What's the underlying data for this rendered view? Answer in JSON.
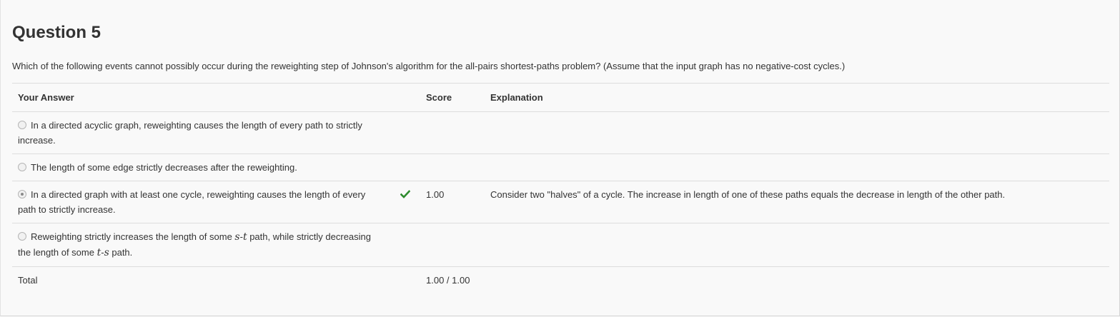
{
  "question": {
    "title": "Question 5",
    "text": "Which of the following events cannot possibly occur during the reweighting step of Johnson's algorithm for the all-pairs shortest-paths problem? (Assume that the input graph has no negative-cost cycles.)"
  },
  "table": {
    "headers": {
      "answer": "Your Answer",
      "score": "Score",
      "explanation": "Explanation"
    },
    "rows": [
      {
        "text": "In a directed acyclic graph, reweighting causes the length of every path to strictly increase.",
        "selected": false,
        "score": "",
        "explanation": ""
      },
      {
        "text": "The length of some edge strictly decreases after the reweighting.",
        "selected": false,
        "score": "",
        "explanation": ""
      },
      {
        "text": "In a directed graph with at least one cycle, reweighting causes the length of every path to strictly increase.",
        "selected": true,
        "correct": true,
        "score": "1.00",
        "explanation": "Consider two \"halves\" of a cycle. The increase in length of one of these paths equals the decrease in length of the other path."
      },
      {
        "text_parts": {
          "p1": "Reweighting strictly increases the length of some ",
          "m1": "s",
          "dash1": "-",
          "m2": "t",
          "p2": " path, while strictly decreasing the length of some ",
          "m3": "t",
          "dash2": "-",
          "m4": "s",
          "p3": " path."
        },
        "selected": false,
        "score": "",
        "explanation": ""
      }
    ],
    "total": {
      "label": "Total",
      "score": "1.00 / 1.00"
    }
  },
  "icons": {
    "correct": "checkmark-icon",
    "radio": "radio-button-icon"
  },
  "colors": {
    "check_green": "#2e8b2e",
    "background": "#f9f9f9",
    "text": "#333333",
    "rule": "#dddddd"
  }
}
